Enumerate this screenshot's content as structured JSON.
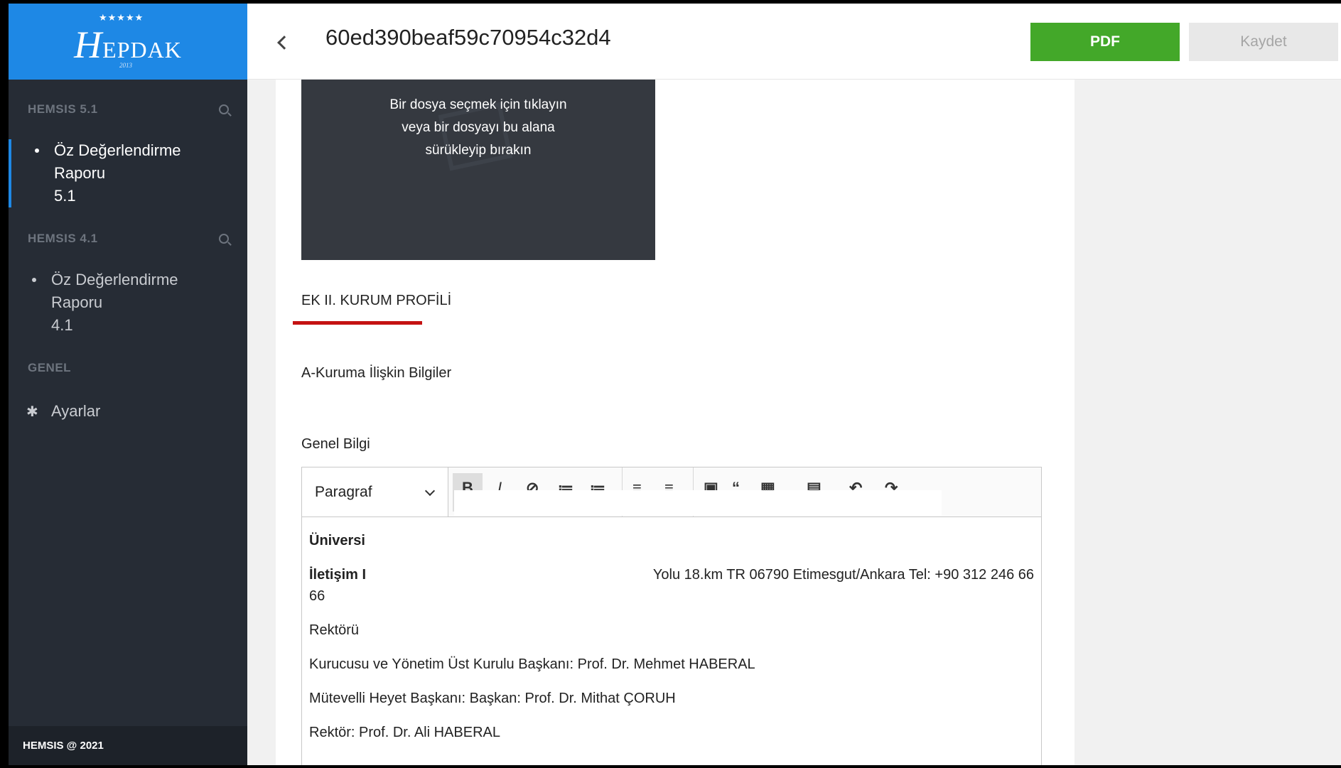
{
  "sidebar": {
    "logo_text": "EPDAK",
    "logo_initial": "H",
    "logo_year": "2013",
    "logo_stars": "★★★★★",
    "sections": [
      {
        "title": "HEMSIS 5.1",
        "items": [
          {
            "line1": "Öz Değerlendirme Raporu",
            "line2": "5.1"
          }
        ]
      },
      {
        "title": "HEMSIS 4.1",
        "items": [
          {
            "line1": "Öz Değerlendirme Raporu",
            "line2": "4.1"
          }
        ]
      },
      {
        "title": "GENEL",
        "items": [
          {
            "label": "Ayarlar"
          }
        ]
      }
    ],
    "footer": "HEMSIS @ 2021"
  },
  "header": {
    "title": "60ed390beaf59c70954c32d4",
    "pdf_label": "PDF",
    "save_label": "Kaydet"
  },
  "main": {
    "dropzone_lines": [
      "Bir dosya seçmek için tıklayın",
      "veya bir dosyayı bu alana",
      "sürükleyip bırakın"
    ],
    "section_title": "EK II. KURUM PROFİLİ",
    "subsection": "A-Kuruma İlişkin Bilgiler",
    "field_label": "Genel Bilgi",
    "editor": {
      "block_format": "Paragraf",
      "content": {
        "line1": "Üniversi",
        "line2_left": "İletişim I",
        "line2_right": "Yolu 18.km TR 06790 Etimesgut/Ankara Tel: +90 312 246 66",
        "line2_cont": "66",
        "line3": "Rektörü",
        "line4": "Kurucusu ve Yönetim Üst Kurulu Başkanı: Prof. Dr. Mehmet HABERAL",
        "line5": "Mütevelli Heyet Başkanı: Başkan: Prof. Dr. Mithat ÇORUH",
        "line6": "Rektör: Prof. Dr. Ali HABERAL"
      }
    }
  },
  "colors": {
    "sidebar_bg": "#262c35",
    "logo_bg": "#1e88e5",
    "pdf_button": "#43a829",
    "accent_underline": "#c41212"
  }
}
